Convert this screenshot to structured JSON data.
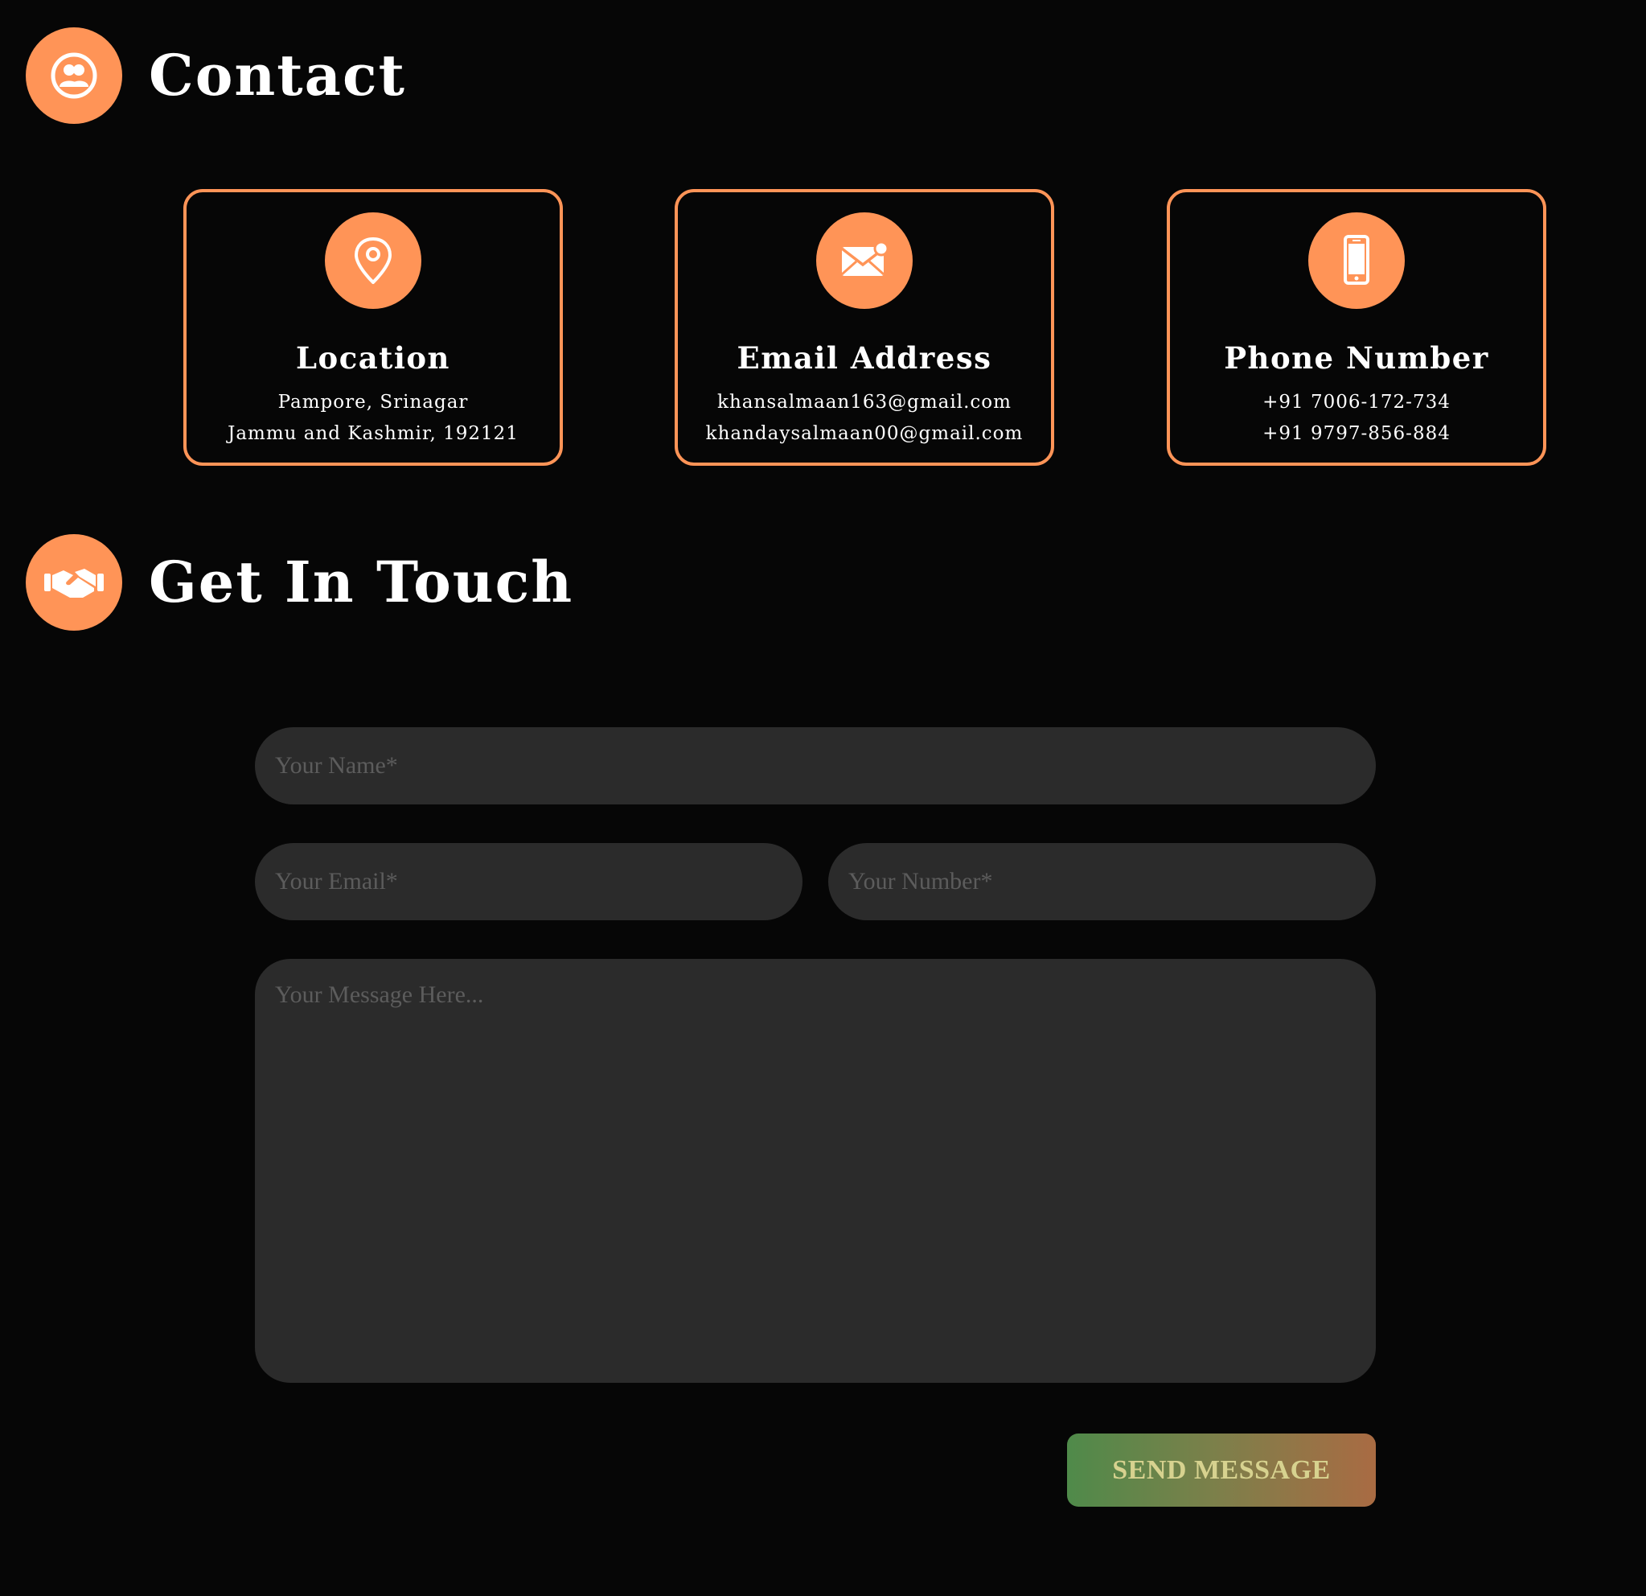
{
  "contact": {
    "title": "Contact",
    "icon": "contacts-icon"
  },
  "cards": [
    {
      "icon": "map-pin-icon",
      "title": "Location",
      "lines": [
        "Pampore, Srinagar",
        "Jammu and Kashmir, 192121"
      ]
    },
    {
      "icon": "envelope-icon",
      "title": "Email Address",
      "lines": [
        "khansalmaan163@gmail.com",
        "khandaysalmaan00@gmail.com"
      ]
    },
    {
      "icon": "phone-icon",
      "title": "Phone Number",
      "lines": [
        "+91 7006-172-734",
        "+91 9797-856-884"
      ]
    }
  ],
  "get_in_touch": {
    "title": "Get In Touch",
    "icon": "handshake-icon"
  },
  "form": {
    "name_placeholder": "Your Name*",
    "email_placeholder": "Your Email*",
    "number_placeholder": "Your Number*",
    "message_placeholder": "Your Message Here...",
    "send_label": "SEND MESSAGE"
  },
  "colors": {
    "background": "#060606",
    "accent": "#ff9457",
    "field_bg": "#2b2b2b",
    "placeholder": "#5c5c5c",
    "button_gradient_start": "#4f8a4a",
    "button_gradient_end": "#a96b43",
    "button_text": "#d7d28f"
  }
}
